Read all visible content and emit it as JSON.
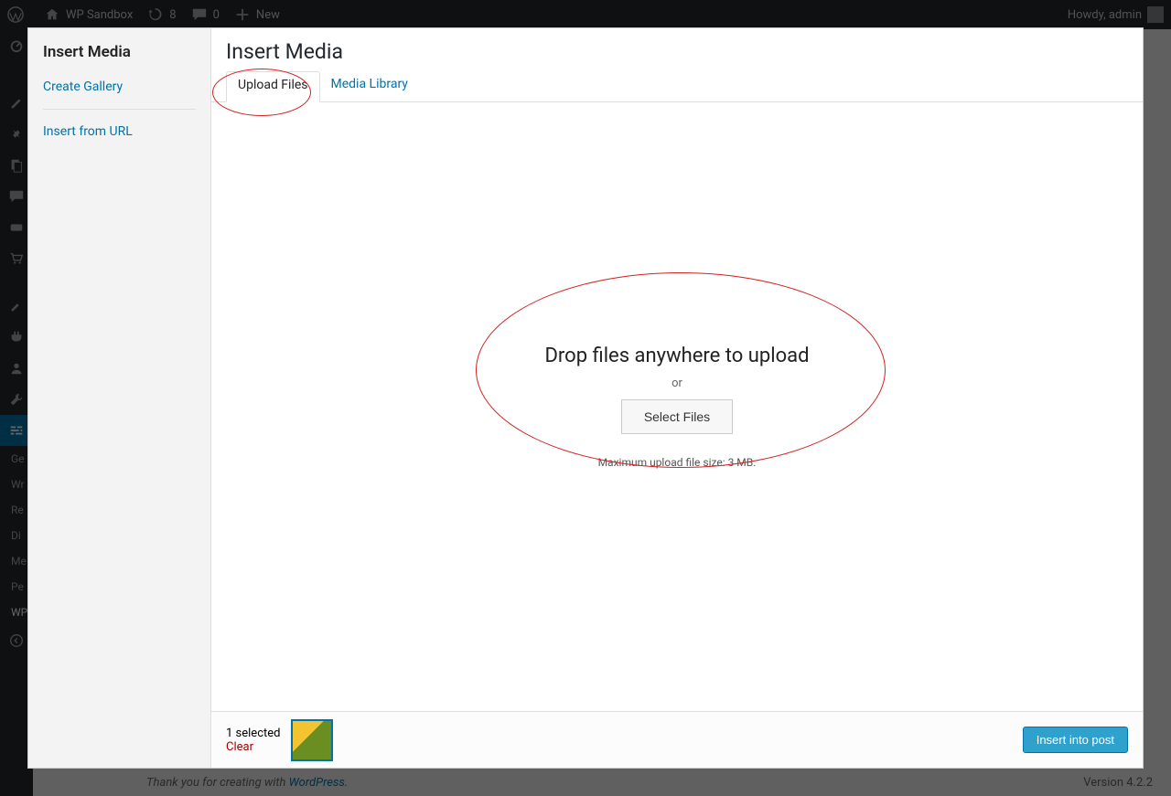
{
  "adminbar": {
    "site_name": "WP Sandbox",
    "updates_count": "8",
    "comments_count": "0",
    "new_label": "New",
    "howdy": "Howdy, admin"
  },
  "sidebar_labels": {
    "ge": "Ge",
    "wr": "Wr",
    "re": "Re",
    "di": "Di",
    "me": "Me",
    "pe": "Pe",
    "wp": "WP"
  },
  "footer": {
    "thanks_prefix": "Thank you for creating with ",
    "wp_link": "WordPress.",
    "version": "Version 4.2.2"
  },
  "modal": {
    "close": "✕",
    "sidebar": {
      "title": "Insert Media",
      "create_gallery": "Create Gallery",
      "insert_from_url": "Insert from URL"
    },
    "header_title": "Insert Media",
    "tabs": {
      "upload_files": "Upload Files",
      "media_library": "Media Library"
    },
    "drop_text": "Drop files anywhere to upload",
    "or_text": "or",
    "select_files_btn": "Select Files",
    "max_text": "Maximum upload file size: 3 MB.",
    "toolbar": {
      "selected_text": "1 selected",
      "clear_text": "Clear",
      "insert_btn": "Insert into post"
    }
  }
}
